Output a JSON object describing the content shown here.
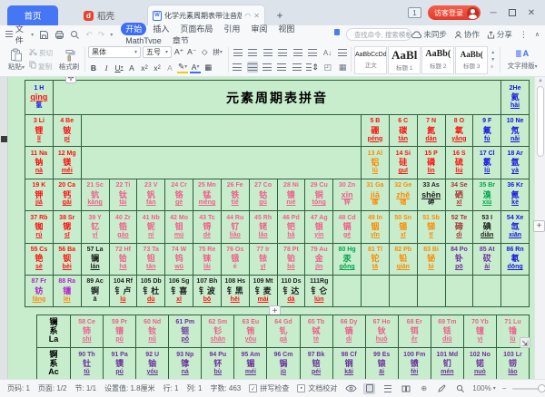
{
  "window": {
    "tab_home": "首页",
    "tab_docer": "稻壳",
    "doc_tab": "化学元素周期表带注音版.doc",
    "doc_icon": "W",
    "badge": "1",
    "login": "访客登录"
  },
  "menubar": {
    "file": "文件",
    "items": [
      "开始",
      "插入",
      "页面布局",
      "引用",
      "审阅",
      "视图",
      "MathType",
      "章节"
    ],
    "active": "开始",
    "search_placeholder": "查找命令, 搜索模板",
    "sync_label": "未同步",
    "collab_label": "协作",
    "share_label": "分享"
  },
  "ribbon": {
    "paste": "粘贴",
    "cut": "剪切",
    "copy": "复制",
    "format_painter": "格式刷",
    "font_name": "黑体",
    "font_size": "五号",
    "styles": [
      {
        "preview": "AaBbCcDd",
        "label": "正文"
      },
      {
        "preview": "AaBl",
        "label": "标题 1"
      },
      {
        "preview": "AaBb(",
        "label": "标题 2"
      },
      {
        "preview": "AaBb(",
        "label": "标题 3"
      }
    ],
    "text_layout": "文字排版"
  },
  "doc": {
    "table_title": "元素周期表拼音"
  },
  "table": {
    "palette": {
      "R": "#ff1111",
      "P": "#f0608e",
      "O": "#ff8a00",
      "B": "#1414e6",
      "G": "#00a44c",
      "V": "#7030a0",
      "M": "#b622cc",
      "D": "#a33535",
      "K": "#1f1f1f"
    },
    "rows": [
      [
        [
          "1 H",
          "qīng",
          "氢",
          "B",
          "R"
        ],
        {
          "t": 16
        },
        [
          "2He",
          "氦",
          "hài",
          "B"
        ]
      ],
      [
        [
          "3 Li",
          "锂",
          "lǐ",
          "R"
        ],
        [
          "4 Be",
          "铍",
          "pí",
          "R"
        ],
        {
          "s": 10
        },
        [
          "5 B",
          "硼",
          "péng",
          "R"
        ],
        [
          "6 C",
          "碳",
          "tàn",
          "R"
        ],
        [
          "7 N",
          "氮",
          "dàn",
          "R"
        ],
        [
          "8 O",
          "氧",
          "yǎng",
          "R"
        ],
        [
          "9 F",
          "氟",
          "fú",
          "B"
        ],
        [
          "10 Ne",
          "氖",
          "nǎi",
          "B"
        ]
      ],
      [
        [
          "11 Na",
          "钠",
          "nà",
          "R"
        ],
        [
          "12 Mg",
          "镁",
          "měi",
          "R"
        ],
        {
          "s": 10
        },
        [
          "13 Al",
          "铝",
          "lǚ",
          "O"
        ],
        [
          "14 Si",
          "硅",
          "guī",
          "R"
        ],
        [
          "15 P",
          "磷",
          "lín",
          "R"
        ],
        [
          "16 S",
          "硫",
          "liú",
          "R"
        ],
        [
          "17 Cl",
          "氯",
          "lǜ",
          "B"
        ],
        [
          "18 Ar",
          "氩",
          "yà",
          "B"
        ]
      ],
      [
        [
          "19 K",
          "钾",
          "jiǎ",
          "R"
        ],
        [
          "20 Ca",
          "钙",
          "gài",
          "R"
        ],
        [
          "21 Sc",
          "钪",
          "kàng",
          "P"
        ],
        [
          "22 Ti",
          "钛",
          "tài",
          "P"
        ],
        [
          "23 V",
          "钒",
          "fán",
          "P"
        ],
        [
          "24 Cr",
          "铬",
          "gè",
          "P"
        ],
        [
          "25 Mn",
          "锰",
          "měng",
          "P"
        ],
        [
          "26 Fe",
          "铁",
          "tiě",
          "P"
        ],
        [
          "27 Co",
          "钴",
          "gǔ",
          "P"
        ],
        [
          "28 Ni",
          "镍",
          "niè",
          "P"
        ],
        [
          "29 Cu",
          "铜",
          "tóng",
          "P"
        ],
        [
          "30 Zn",
          "xīn",
          "锌",
          "P"
        ],
        [
          "31 Ga",
          "jiā",
          "镓",
          "O"
        ],
        [
          "32 Ge",
          "zhě",
          "锗",
          "O"
        ],
        [
          "33 As",
          "shēn",
          "砷",
          "K"
        ],
        [
          "34 Se",
          "硒",
          "xī",
          "D"
        ],
        [
          "35 Br",
          "溴",
          "xiù",
          "G"
        ],
        [
          "36 Kr",
          "氪",
          "kè",
          "B"
        ]
      ],
      [
        [
          "37 Rb",
          "铷",
          "rú",
          "R"
        ],
        [
          "38 Sr",
          "锶",
          "sī",
          "R"
        ],
        [
          "39 Y",
          "钇",
          "yǐ",
          "P"
        ],
        [
          "40 Zr",
          "锆",
          "gào",
          "P"
        ],
        [
          "41 Nb",
          "铌",
          "ní",
          "P"
        ],
        [
          "42 Mo",
          "钼",
          "mù",
          "P"
        ],
        [
          "43 Tc",
          "锝",
          "dé",
          "P"
        ],
        [
          "44 Ru",
          "钌",
          "liǎo",
          "P"
        ],
        [
          "45 Rh",
          "铑",
          "lǎo",
          "P"
        ],
        [
          "46 Pd",
          "钯",
          "bǎ",
          "P"
        ],
        [
          "47 Ag",
          "银",
          "yín",
          "P"
        ],
        [
          "48 Cd",
          "镉",
          "gé",
          "P"
        ],
        [
          "49 In",
          "铟",
          "yīn",
          "O"
        ],
        [
          "50 Sn",
          "锡",
          "xī",
          "O"
        ],
        [
          "51 Sb",
          "锑",
          "tī",
          "O"
        ],
        [
          "52 Te",
          "碲",
          "dì",
          "D"
        ],
        [
          "53 I",
          "碘",
          "diǎn",
          "K"
        ],
        [
          "54 Xe",
          "氙",
          "xiān",
          "B"
        ]
      ],
      [
        [
          "55 Cs",
          "铯",
          "sè",
          "R"
        ],
        [
          "56 Ba",
          "钡",
          "bèi",
          "R"
        ],
        [
          "57 La",
          "镧",
          "lán",
          "K"
        ],
        [
          "72 Hf",
          "铪",
          "hā",
          "P"
        ],
        [
          "73 Ta",
          "钽",
          "tǎn",
          "P"
        ],
        [
          "74 W",
          "钨",
          "wū",
          "P"
        ],
        [
          "75 Re",
          "铼",
          "lái",
          "P"
        ],
        [
          "76 Os",
          "锇",
          "é",
          "P"
        ],
        [
          "77 Ir",
          "铱",
          "yī",
          "P"
        ],
        [
          "78 Pt",
          "铂",
          "bó",
          "P"
        ],
        [
          "79 Au",
          "金",
          "jīn",
          "P"
        ],
        [
          "80 Hg",
          "汞",
          "gǒng",
          "G"
        ],
        [
          "81 Tl",
          "铊",
          "tā",
          "O"
        ],
        [
          "82 Pb",
          "铅",
          "qiān",
          "O"
        ],
        [
          "83 Bi",
          "铋",
          "bì",
          "O"
        ],
        [
          "84 Po",
          "钋",
          "pō",
          "V"
        ],
        [
          "85 At",
          "砹",
          "ài",
          "V"
        ],
        [
          "86 Rn",
          "氡",
          "dōng",
          "B"
        ]
      ],
      [
        [
          "87 Fr",
          "钫",
          "fāng",
          "M",
          "O"
        ],
        [
          "88 Ra",
          "镭",
          "léi",
          "M",
          "O"
        ],
        [
          "89 Ac",
          "锕",
          "ā",
          "K"
        ],
        [
          "104 Rf",
          "钅卢",
          "lú",
          "K",
          "R"
        ],
        [
          "105 Db",
          "钅杜",
          "dù",
          "K",
          "R"
        ],
        [
          "106 Sg",
          "钅喜",
          "xǐ",
          "K",
          "R"
        ],
        [
          "107 Bh",
          "钅波",
          "bō",
          "K",
          "R"
        ],
        [
          "108 Hs",
          "钅黑",
          "hēi",
          "K",
          "R"
        ],
        [
          "109 Mt",
          "钅麦",
          "mài",
          "K",
          "R"
        ],
        [
          "110 Ds",
          "钅达",
          "dá",
          "K",
          "R"
        ],
        [
          "111Rg",
          "钅仑",
          "lún",
          "K",
          "R"
        ],
        {
          "e": 7
        }
      ]
    ],
    "lan_header": [
      "镧",
      "系",
      "La"
    ],
    "act_header": [
      "锕",
      "系",
      "Ac"
    ],
    "lanthanides": [
      [
        "58 Ce",
        "铈",
        "shì",
        "P"
      ],
      [
        "59 Pr",
        "镨",
        "pǔ",
        "P"
      ],
      [
        "60 Nd",
        "钕",
        "nǚ",
        "P"
      ],
      [
        "61 Pm",
        "钷",
        "pǒ",
        "V"
      ],
      [
        "62 Sm",
        "钐",
        "shān",
        "P"
      ],
      [
        "63 Eu",
        "铕",
        "yǒu",
        "P"
      ],
      [
        "64 Gd",
        "钆",
        "gá",
        "P"
      ],
      [
        "65 Tb",
        "铽",
        "tè",
        "P"
      ],
      [
        "66 Dy",
        "镝",
        "dí",
        "P"
      ],
      [
        "67 Ho",
        "钬",
        "huǒ",
        "P"
      ],
      [
        "68 Er",
        "铒",
        "ěr",
        "P"
      ],
      [
        "69 Tm",
        "铥",
        "diū",
        "P"
      ],
      [
        "70 Yb",
        "镱",
        "yì",
        "P"
      ],
      [
        "71 Lu",
        "镥",
        "lǔ",
        "P"
      ]
    ],
    "actinides": [
      [
        "90 Th",
        "钍",
        "tǔ",
        "V"
      ],
      [
        "91 Pa",
        "镤",
        "pú",
        "V"
      ],
      [
        "92 U",
        "铀",
        "yóu",
        "V"
      ],
      [
        "93 Np",
        "镎",
        "ná",
        "V"
      ],
      [
        "94 Pu",
        "钚",
        "bù",
        "V"
      ],
      [
        "95 Am",
        "镅",
        "méi",
        "V"
      ],
      [
        "96 Cm",
        "锔",
        "jū",
        "V"
      ],
      [
        "97 Bk",
        "锫",
        "péi",
        "V"
      ],
      [
        "98 Cf",
        "锎",
        "kāi",
        "V"
      ],
      [
        "99 Es",
        "锿",
        "āi",
        "V"
      ],
      [
        "100 Fm",
        "镄",
        "fèi",
        "V"
      ],
      [
        "101 Md",
        "钔",
        "mén",
        "V"
      ],
      [
        "102 No",
        "锘",
        "nuò",
        "V"
      ],
      [
        "103 Lr",
        "铹",
        "láo",
        "V"
      ]
    ]
  },
  "statusbar": {
    "items": [
      "页码: 1",
      "页面: 1/2",
      "节: 1/1",
      "设置值: 1.8厘米",
      "行: 1",
      "列: 1",
      "字数: 463"
    ],
    "spell_label": "拼写检查",
    "proof_label": "文档校对",
    "zoom": "100%"
  }
}
